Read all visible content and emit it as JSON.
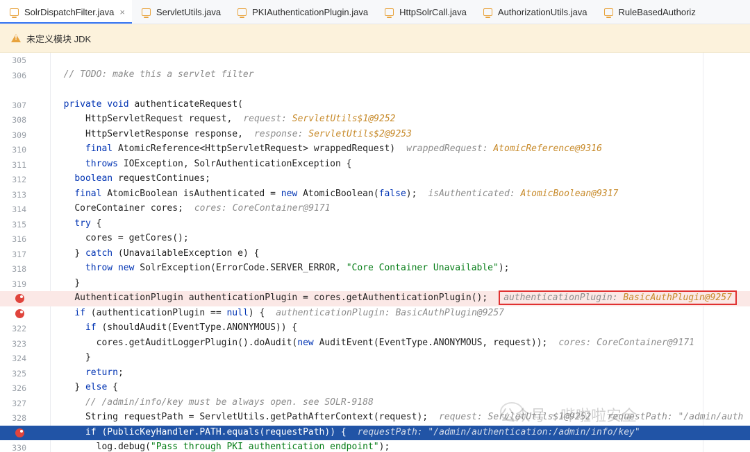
{
  "tabs": [
    {
      "label": "SolrDispatchFilter.java",
      "active": true,
      "close": "×"
    },
    {
      "label": "ServletUtils.java"
    },
    {
      "label": "PKIAuthenticationPlugin.java"
    },
    {
      "label": "HttpSolrCall.java"
    },
    {
      "label": "AuthorizationUtils.java"
    },
    {
      "label": "RuleBasedAuthoriz"
    }
  ],
  "banner": {
    "text": "未定义模块 JDK"
  },
  "lines": [
    {
      "n": "305",
      "indent": 0,
      "code": ""
    },
    {
      "n": "306",
      "indent": 2,
      "code": "// TODO: make this a servlet filter",
      "comment": true
    },
    {
      "n": "",
      "indent": 0,
      "code": ""
    },
    {
      "n": "307",
      "indent": 2,
      "code": "private void authenticateRequest("
    },
    {
      "n": "308",
      "indent": 6,
      "code": "HttpServletRequest request,",
      "hint": "request: ",
      "hintv": "ServletUtils$1@9252"
    },
    {
      "n": "309",
      "indent": 6,
      "code": "HttpServletResponse response,",
      "hint": "response: ",
      "hintv": "ServletUtils$2@9253"
    },
    {
      "n": "310",
      "indent": 6,
      "code": "final AtomicReference<HttpServletRequest> wrappedRequest)",
      "hint": "wrappedRequest: ",
      "hintv": "AtomicReference@9316"
    },
    {
      "n": "311",
      "indent": 6,
      "code": "throws IOException, SolrAuthenticationException {"
    },
    {
      "n": "312",
      "indent": 4,
      "code": "boolean requestContinues;"
    },
    {
      "n": "313",
      "indent": 4,
      "code": "final AtomicBoolean isAuthenticated = new AtomicBoolean(false);",
      "hint": "isAuthenticated: ",
      "hintv": "AtomicBoolean@9317"
    },
    {
      "n": "314",
      "indent": 4,
      "code": "CoreContainer cores;",
      "hint": "cores: CoreContainer@9171"
    },
    {
      "n": "315",
      "indent": 4,
      "code": "try {"
    },
    {
      "n": "316",
      "indent": 6,
      "code": "cores = getCores();"
    },
    {
      "n": "317",
      "indent": 4,
      "code": "} catch (UnavailableException e) {"
    },
    {
      "n": "318",
      "indent": 6,
      "code": "throw new SolrException(ErrorCode.SERVER_ERROR, \"Core Container Unavailable\");"
    },
    {
      "n": "319",
      "indent": 4,
      "code": "}"
    },
    {
      "n": "",
      "bp": true,
      "style": "bp",
      "indent": 4,
      "code": "AuthenticationPlugin authenticationPlugin = cores.getAuthenticationPlugin();",
      "hint": "authenticationPlugin: ",
      "hintv": "BasicAuthPlugin@9257",
      "boxed": true
    },
    {
      "n": "",
      "bp": true,
      "indent": 4,
      "code": "if (authenticationPlugin == null) {",
      "hint": "authenticationPlugin: BasicAuthPlugin@9257"
    },
    {
      "n": "322",
      "indent": 6,
      "code": "if (shouldAudit(EventType.ANONYMOUS)) {"
    },
    {
      "n": "323",
      "indent": 8,
      "code": "cores.getAuditLoggerPlugin().doAudit(new AuditEvent(EventType.ANONYMOUS, request));",
      "hint": "cores: CoreContainer@9171"
    },
    {
      "n": "324",
      "indent": 6,
      "code": "}"
    },
    {
      "n": "325",
      "indent": 6,
      "code": "return;"
    },
    {
      "n": "326",
      "indent": 4,
      "code": "} else {"
    },
    {
      "n": "327",
      "indent": 6,
      "code": "// /admin/info/key must be always open. see SOLR-9188",
      "comment": true
    },
    {
      "n": "328",
      "indent": 6,
      "code": "String requestPath = ServletUtils.getPathAfterContext(request);",
      "hint": "request: ServletUtils$1@9252   requestPath: \"/admin/auth"
    },
    {
      "n": "",
      "bp": true,
      "style": "cur",
      "indent": 6,
      "code": "if (PublicKeyHandler.PATH.equals(requestPath)) {",
      "hint": "requestPath: \"/admin/authentication:/admin/info/key\""
    },
    {
      "n": "330",
      "indent": 8,
      "code": "log.debug(\"Pass through PKI authentication endpoint\");"
    }
  ],
  "watermark": "公众号 · 哔啦啦安全"
}
